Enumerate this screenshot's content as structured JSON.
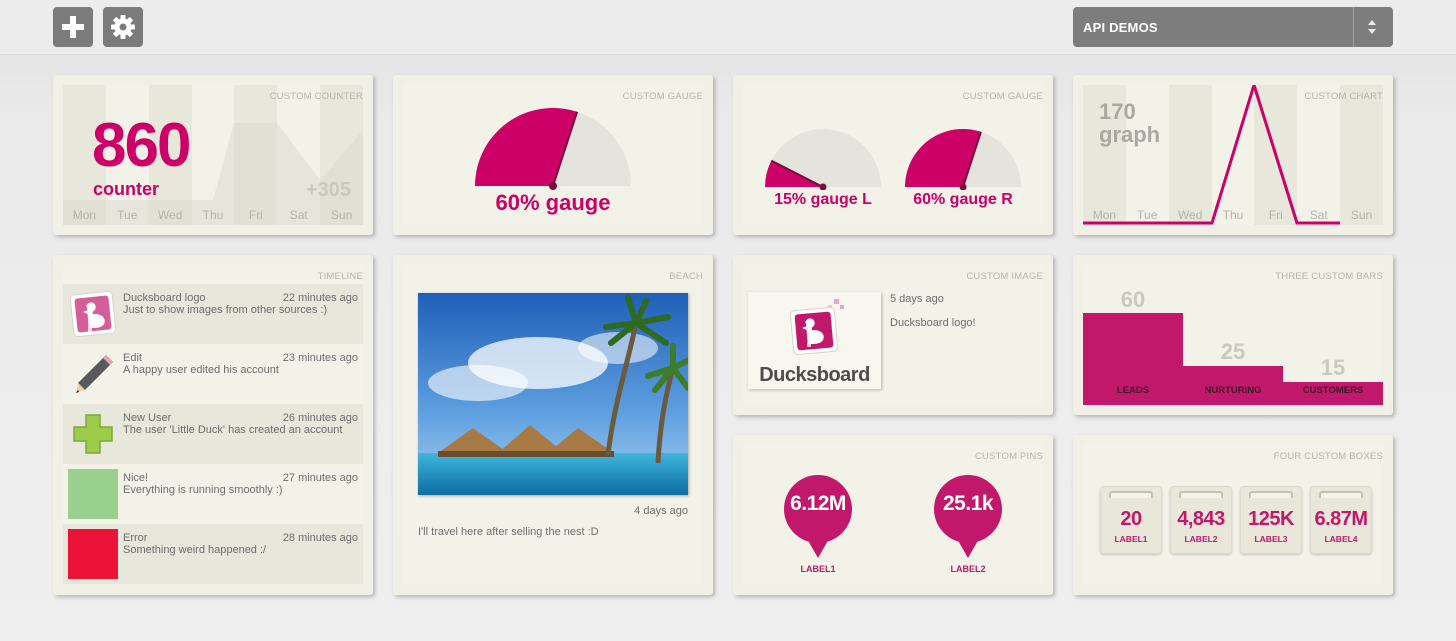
{
  "toolbar": {
    "add_icon": "plus-icon",
    "settings_icon": "gear-icon"
  },
  "dashboard_select": {
    "selected": "API DEMOS"
  },
  "colors": {
    "accent": "#cc0066",
    "bars": "#c2186b",
    "panel": "#f1f0e6"
  },
  "widgets": {
    "counter": {
      "title": "CUSTOM COUNTER",
      "value": "860",
      "label": "counter",
      "delta": "+305",
      "days": [
        "Mon",
        "Tue",
        "Wed",
        "Thu",
        "Fri",
        "Sat",
        "Sun"
      ]
    },
    "gauge1": {
      "title": "CUSTOM GAUGE",
      "label": "60% gauge",
      "fraction": 0.6
    },
    "gauge2": {
      "title": "CUSTOM GAUGE",
      "left": {
        "label": "15% gauge L",
        "fraction": 0.15
      },
      "right": {
        "label": "60% gauge R",
        "fraction": 0.6
      }
    },
    "chart": {
      "title": "CUSTOM CHART",
      "value": "170",
      "label": "graph",
      "days": [
        "Mon",
        "Tue",
        "Wed",
        "Thu",
        "Fri",
        "Sat",
        "Sun"
      ]
    },
    "timeline": {
      "title": "TIMELINE",
      "items": [
        {
          "who": "Ducksboard logo",
          "msg": "Just to show images from other sources :)",
          "time": "22 minutes ago"
        },
        {
          "who": "Edit",
          "msg": "A happy user edited his account",
          "time": "23 minutes ago"
        },
        {
          "who": "New User",
          "msg": "The user 'Little Duck' has created an account",
          "time": "26 minutes ago"
        },
        {
          "who": "Nice!",
          "msg": "Everything is running smoothly :)",
          "time": "27 minutes ago"
        },
        {
          "who": "Error",
          "msg": "Something weird happened :/",
          "time": "28 minutes ago"
        }
      ]
    },
    "beach": {
      "title": "BEACH",
      "time": "4 days ago",
      "caption": "I'll travel here after selling the nest :D"
    },
    "image": {
      "title": "CUSTOM IMAGE",
      "time": "5 days ago",
      "caption": "Ducksboard logo!",
      "logo_text": "Ducksboard"
    },
    "bars": {
      "title": "THREE CUSTOM BARS",
      "items": [
        {
          "label": "LEADS",
          "value": "60"
        },
        {
          "label": "NURTURING",
          "value": "25"
        },
        {
          "label": "CUSTOMERS",
          "value": "15"
        }
      ]
    },
    "pins": {
      "title": "CUSTOM PINS",
      "items": [
        {
          "value": "6.12M",
          "label": "LABEL1"
        },
        {
          "value": "25.1k",
          "label": "LABEL2"
        }
      ]
    },
    "boxes": {
      "title": "FOUR CUSTOM BOXES",
      "items": [
        {
          "value": "20",
          "label": "LABEL1"
        },
        {
          "value": "4,843",
          "label": "LABEL2"
        },
        {
          "value": "125K",
          "label": "LABEL3"
        },
        {
          "value": "6.87M",
          "label": "LABEL4"
        }
      ]
    }
  }
}
